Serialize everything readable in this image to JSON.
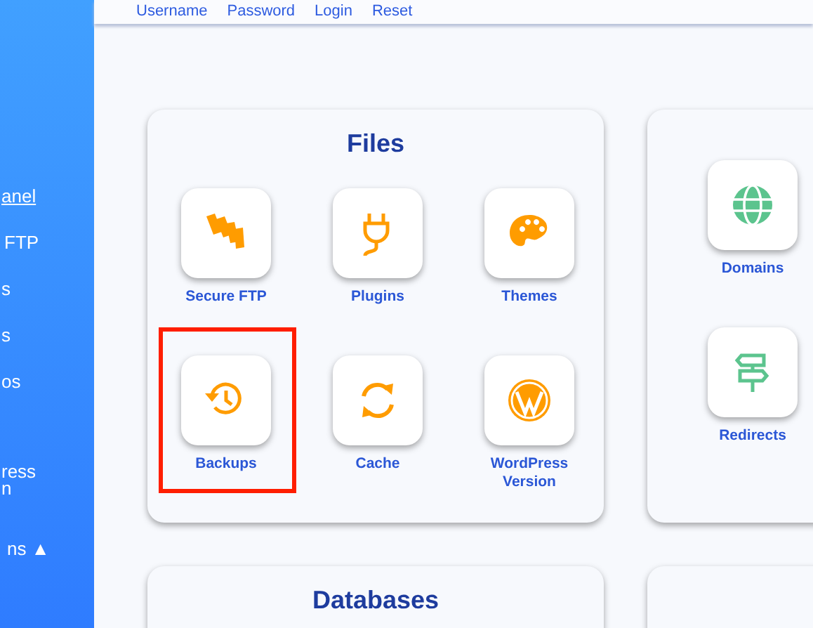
{
  "top_bar": {
    "links": [
      "Username",
      "Password",
      "Login",
      "Reset"
    ]
  },
  "sidebar": {
    "items": [
      {
        "label": "anel",
        "underlined": true
      },
      {
        "label": "FTP",
        "underlined": false
      },
      {
        "label": "s",
        "underlined": false
      },
      {
        "label": "s",
        "underlined": false
      },
      {
        "label": "os",
        "underlined": false
      },
      {
        "label": "ress\nn",
        "underlined": false
      },
      {
        "label": "ns ▲",
        "underlined": false
      }
    ]
  },
  "cards": [
    {
      "title": "Files",
      "tools": [
        {
          "label": "Secure FTP",
          "highlighted": false
        },
        {
          "label": "Plugins",
          "highlighted": false
        },
        {
          "label": "Themes",
          "highlighted": false
        },
        {
          "label": "Backups",
          "highlighted": true
        },
        {
          "label": "Cache",
          "highlighted": false
        },
        {
          "label": "WordPress Version",
          "highlighted": false
        }
      ]
    },
    {
      "tools": [
        {
          "label": "Domains",
          "highlighted": false
        },
        {
          "label": "Redirects",
          "highlighted": false
        }
      ]
    },
    {
      "title": "Databases"
    }
  ]
}
